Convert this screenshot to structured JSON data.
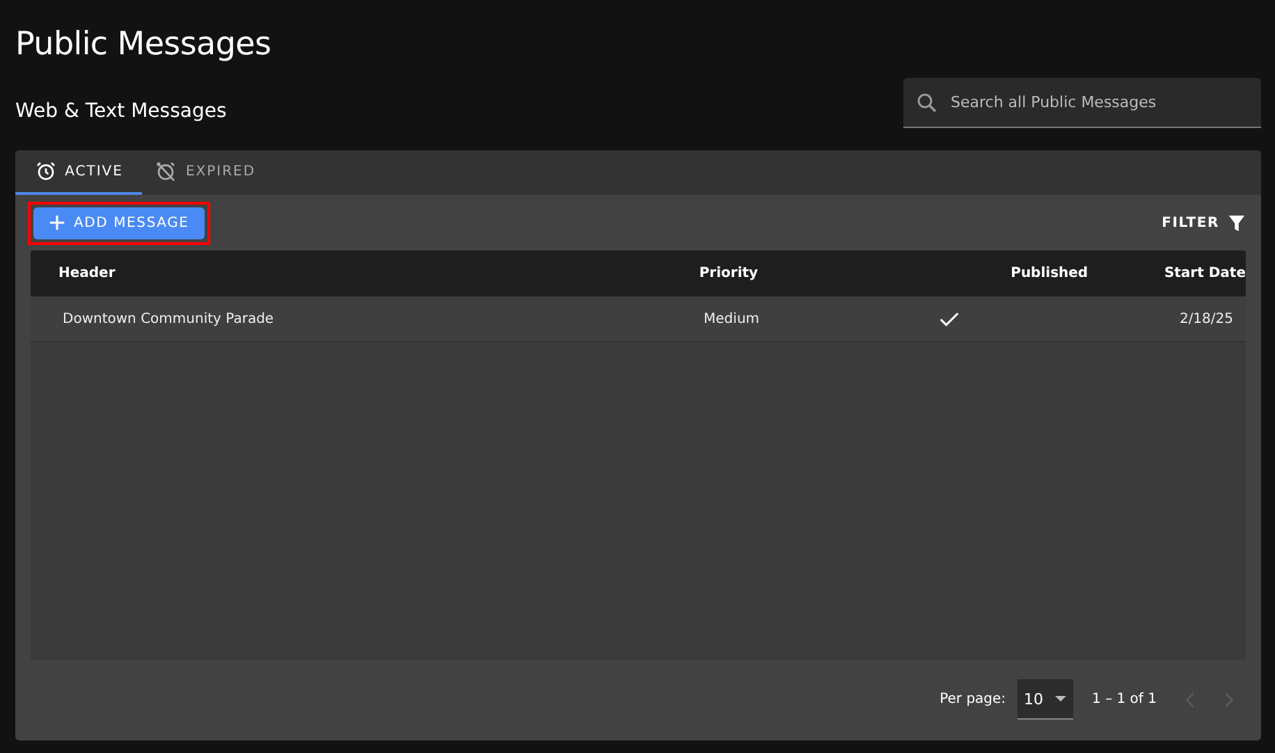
{
  "page": {
    "title": "Public Messages",
    "subtitle": "Web & Text Messages"
  },
  "search": {
    "placeholder": "Search all Public Messages"
  },
  "tabs": [
    {
      "label": "ACTIVE",
      "kind": "active",
      "selected": true
    },
    {
      "label": "EXPIRED",
      "kind": "expired",
      "selected": false
    }
  ],
  "add_button": {
    "label": "ADD MESSAGE",
    "highlighted": true
  },
  "filter": {
    "label": "FILTER"
  },
  "table": {
    "columns": [
      "Header",
      "Priority",
      "Published",
      "Start Date"
    ],
    "rows": [
      {
        "header": "Downtown Community Parade",
        "priority": "Medium",
        "published": true,
        "start_date": "2/18/25"
      }
    ]
  },
  "pagination": {
    "per_page_label": "Per page:",
    "per_page": "10",
    "range": "1 – 1 of 1"
  }
}
